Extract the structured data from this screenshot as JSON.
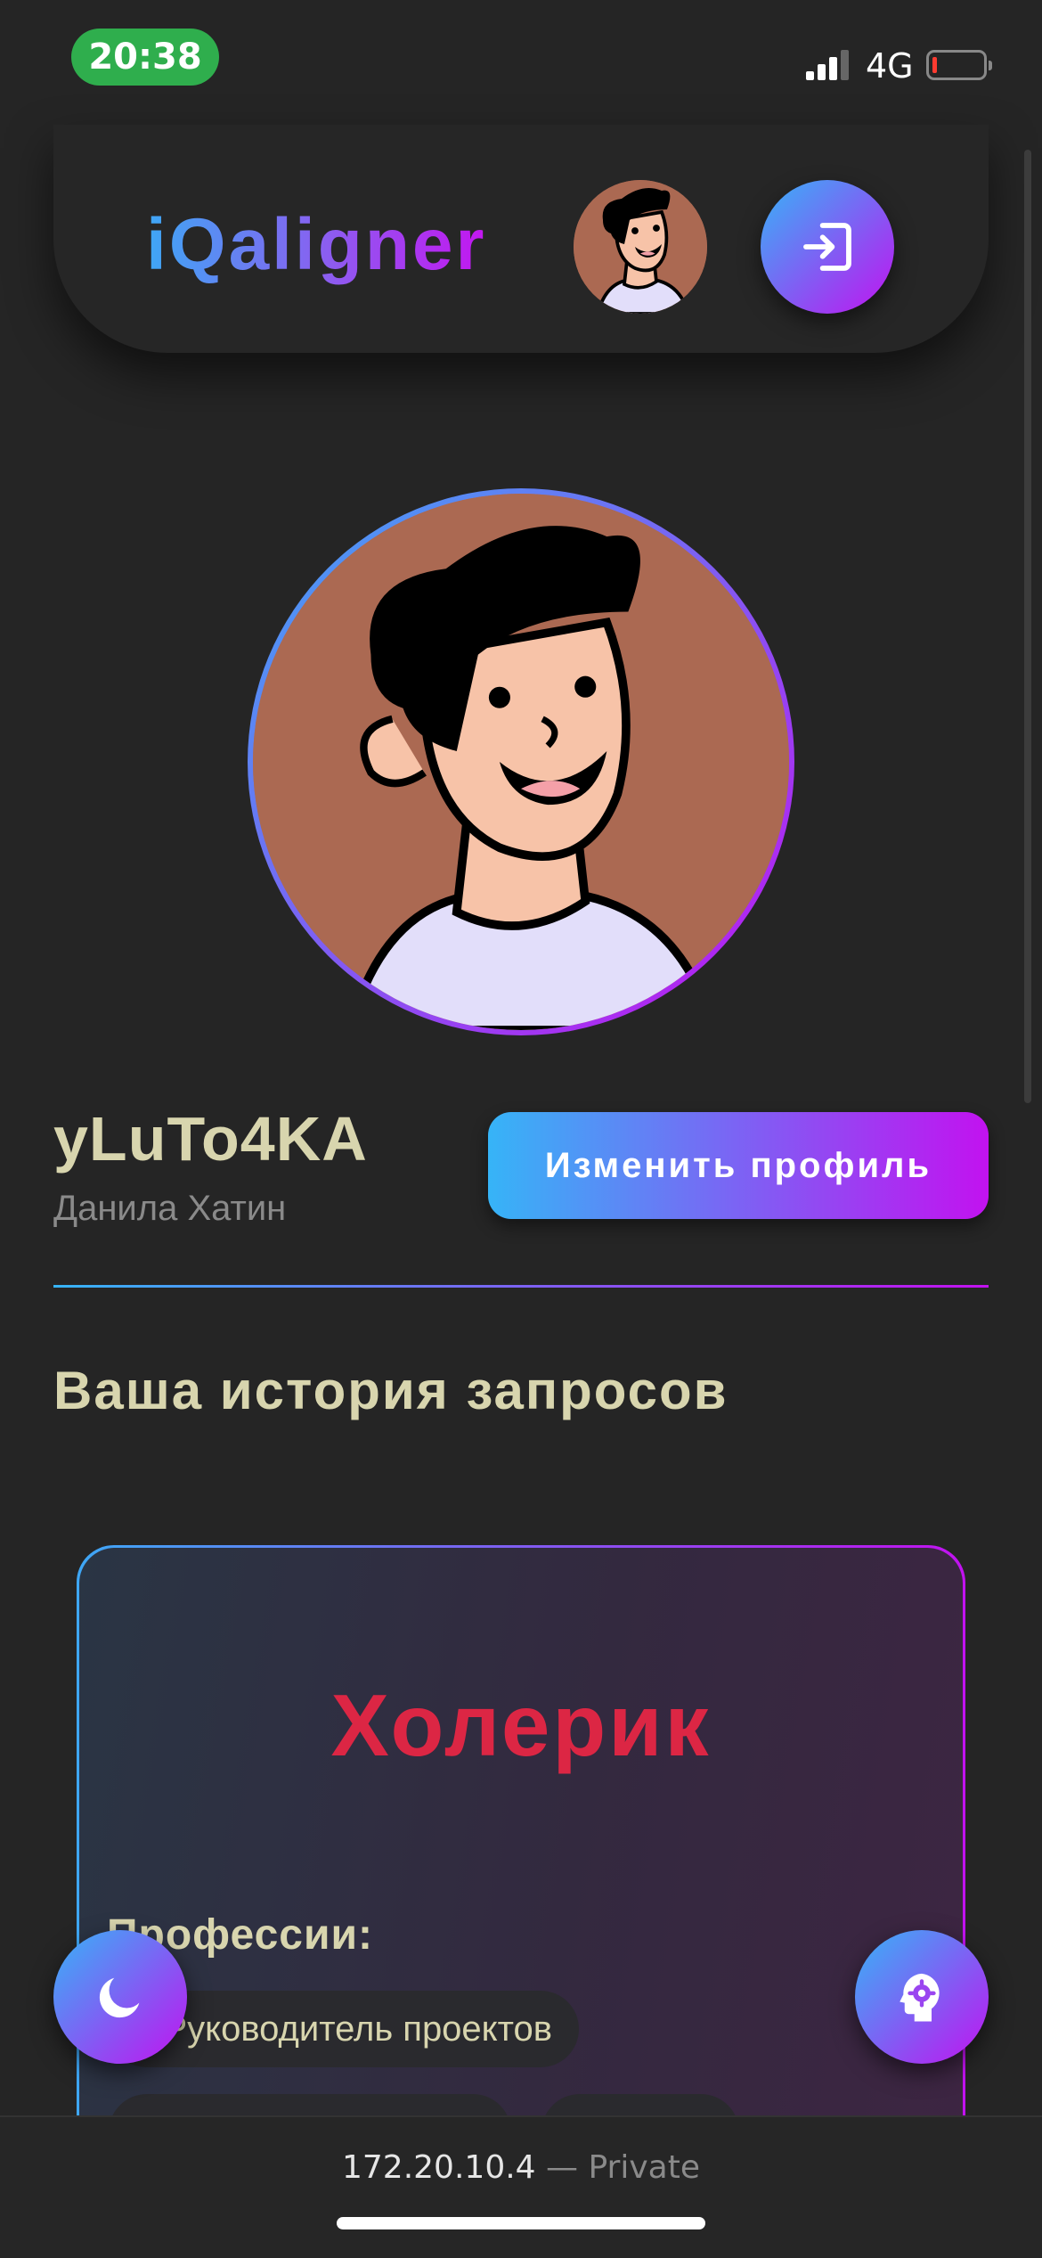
{
  "status_bar": {
    "time": "20:38",
    "network": "4G",
    "battery_level": 0.05,
    "signal_icon": "signal-bars-icon"
  },
  "header": {
    "logo": "iQaligner",
    "logout_icon": "logout-icon"
  },
  "profile": {
    "username": "yLuTo4KA",
    "full_name": "Данила Хатин",
    "edit_button": "Изменить профиль"
  },
  "history": {
    "title": "Ваша история запросов",
    "cards": [
      {
        "temperament": "Холерик",
        "professions_label": "Профессии:",
        "professions": [
          "Руководитель проектов"
        ]
      }
    ]
  },
  "fabs": {
    "theme_icon": "moon-icon",
    "ai_icon": "brain-gear-icon"
  },
  "url_bar": {
    "address": "172.20.10.4",
    "mode": "— Private"
  },
  "colors": {
    "background": "#252525",
    "accent_start": "#36b4f7",
    "accent_end": "#c212f0",
    "temperament": "#dc2644",
    "text_primary": "#d8d5ae"
  }
}
